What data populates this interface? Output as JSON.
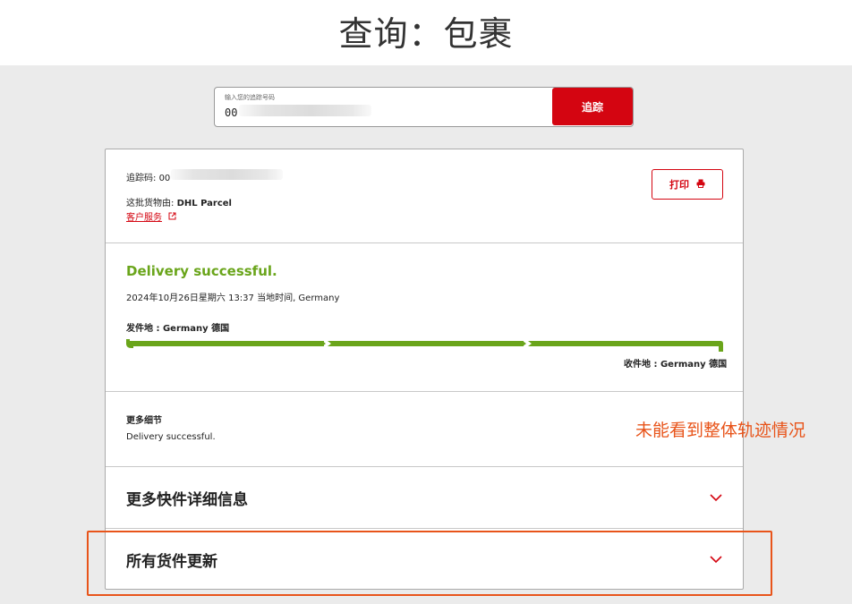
{
  "header": {
    "title": "查询：包裹"
  },
  "search": {
    "label": "输入您的追踪号码",
    "value": "00",
    "button_label": "追踪"
  },
  "shipment": {
    "tracking_label": "追踪码:",
    "tracking_value": "00",
    "carrier_label": "这批货物由:",
    "carrier_name": "DHL Parcel",
    "customer_service_link": "客户服务",
    "print_label": "打印"
  },
  "status": {
    "title": "Delivery successful.",
    "datetime": "2024年10月26日星期六 13:37 当地时间, Germany",
    "origin": "发件地 : Germany 德国",
    "destination": "收件地 : Germany 德国",
    "progress_fraction": 1.0
  },
  "details": {
    "heading": "更多细节",
    "text": "Delivery successful."
  },
  "sections": {
    "more_info": "更多快件详细信息",
    "all_updates": "所有货件更新"
  },
  "annotation": {
    "text": "未能看到整体轨迹情况",
    "color": "#e8541a"
  },
  "colors": {
    "brand_red": "#d40511",
    "success_green": "#6aa51b"
  }
}
